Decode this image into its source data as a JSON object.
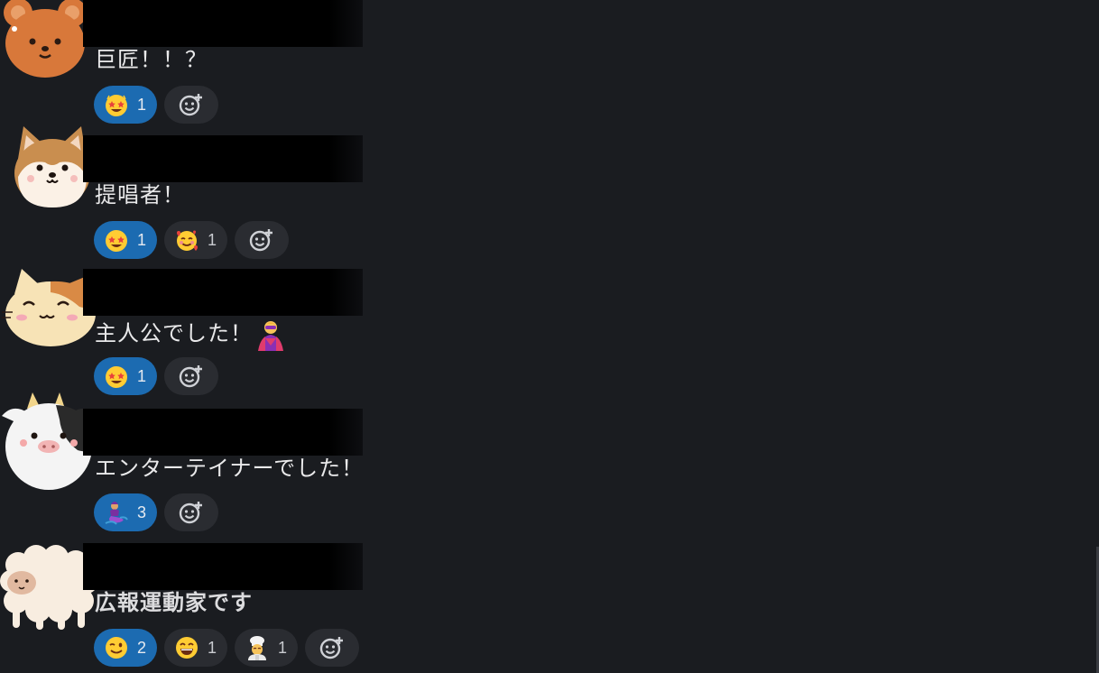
{
  "messages": [
    {
      "avatar": "bear-avatar",
      "name": "",
      "text": "巨匠！！？",
      "reactions": [
        {
          "emoji": "star-struck-emoji",
          "count": "1",
          "mine": true
        }
      ]
    },
    {
      "avatar": "shiba-dog-avatar",
      "name": "",
      "text": "提唱者！",
      "reactions": [
        {
          "emoji": "star-struck-emoji",
          "count": "1",
          "mine": true
        },
        {
          "emoji": "smiling-face-with-hearts-emoji",
          "count": "1",
          "mine": false
        }
      ]
    },
    {
      "avatar": "calico-cat-avatar",
      "name": "",
      "text": "主人公でした！",
      "inline_emoji": "superhero-emoji",
      "reactions": [
        {
          "emoji": "star-struck-emoji",
          "count": "1",
          "mine": true
        }
      ]
    },
    {
      "avatar": "cow-avatar",
      "name": "",
      "text": "エンターテイナーでした！",
      "reactions": [
        {
          "emoji": "genie-emoji",
          "count": "3",
          "mine": true
        }
      ]
    },
    {
      "avatar": "sheep-avatar",
      "name": "",
      "text": "広報運動家です",
      "reactions": [
        {
          "emoji": "winking-face-emoji",
          "count": "2",
          "mine": true
        },
        {
          "emoji": "grinning-face-emoji",
          "count": "1",
          "mine": false
        },
        {
          "emoji": "chef-emoji",
          "count": "1",
          "mine": false
        }
      ]
    }
  ],
  "colors": {
    "background": "#1a1c20",
    "reaction_active": "#1c6bb1",
    "reaction_inactive": "#2a2c31",
    "text": "#e9e9ea"
  }
}
